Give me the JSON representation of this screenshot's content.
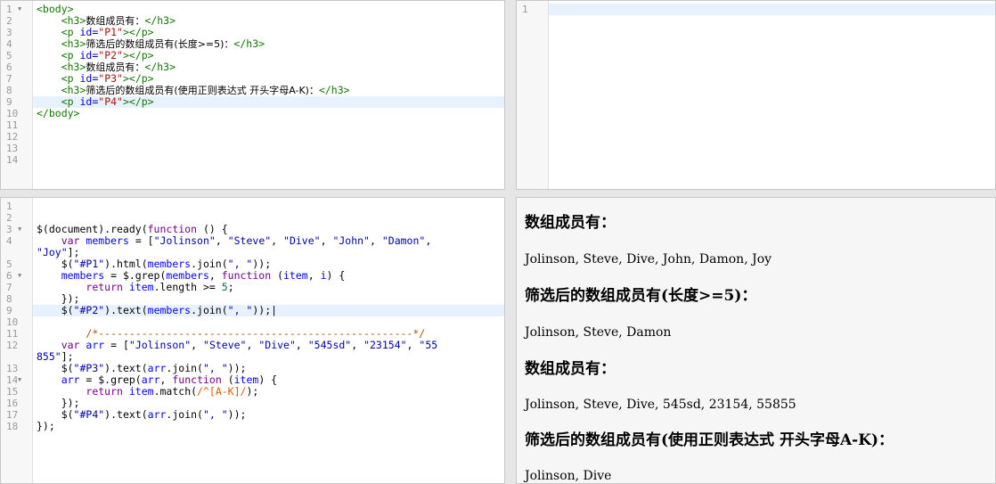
{
  "html_editor": {
    "line_numbers": [
      "1",
      "2",
      "3",
      "4",
      "5",
      "6",
      "7",
      "8",
      "9",
      "10",
      "11",
      "12",
      "13",
      "14"
    ],
    "lines": [
      "<body>",
      "    <h3>数组成员有：</h3>",
      "    <p id=\"P1\"></p>",
      "    <h3>筛选后的数组成员有(长度>=5)：</h3>",
      "    <p id=\"P2\"></p>",
      "    <h3>数组成员有：</h3>",
      "    <p id=\"P3\"></p>",
      "    <h3>筛选后的数组成员有(使用正则表达式 开头字母A-K)：</h3>",
      "    <p id=\"P4\"></p>",
      "</body>"
    ]
  },
  "css_editor": {
    "line_numbers": [
      "1"
    ]
  },
  "js_editor": {
    "line_numbers": [
      "1",
      "2",
      "3",
      "4",
      "",
      "5",
      "6",
      "7",
      "8",
      "9",
      "10",
      "11",
      "12",
      "",
      "13",
      "14",
      "15",
      "16",
      "17",
      "18"
    ],
    "lines": [
      "$(document).ready(function () {",
      "    var members = [\"Jolinson\", \"Steve\", \"Dive\", \"John\", \"Damon\",",
      "\"Joy\"];",
      "    $(\"#P1\").html(members.join(\", \"));",
      "    members = $.grep(members, function (item, i) {",
      "        return item.length >= 5;",
      "    });",
      "    $(\"#P2\").text(members.join(\", \"));",
      "    /*---------------------------------------------------*/",
      "    var arr = [\"Jolinson\", \"Steve\", \"Dive\", \"545sd\", \"23154\", \"55",
      "855\"];",
      "    $(\"#P3\").text(arr.join(\", \"));",
      "    arr = $.grep(arr, function (item) {",
      "        return item.match(/^[A-K]/);",
      "    });",
      "    $(\"#P4\").text(arr.join(\", \"));",
      "});"
    ]
  },
  "output": {
    "h1": "数组成员有：",
    "p1": "Jolinson, Steve, Dive, John, Damon, Joy",
    "h2": "筛选后的数组成员有(长度>=5)：",
    "p2": "Jolinson, Steve, Damon",
    "h3": "数组成员有：",
    "p3": "Jolinson, Steve, Dive, 545sd, 23154, 55855",
    "h4": "筛选后的数组成员有(使用正则表达式 开头字母A-K)：",
    "p4": "Jolinson, Dive"
  },
  "colors": {
    "tag": "#117700",
    "attr": "#0000cc",
    "string": "#aa1111",
    "keyword": "#770088",
    "active_line": "#e8f2ff"
  }
}
